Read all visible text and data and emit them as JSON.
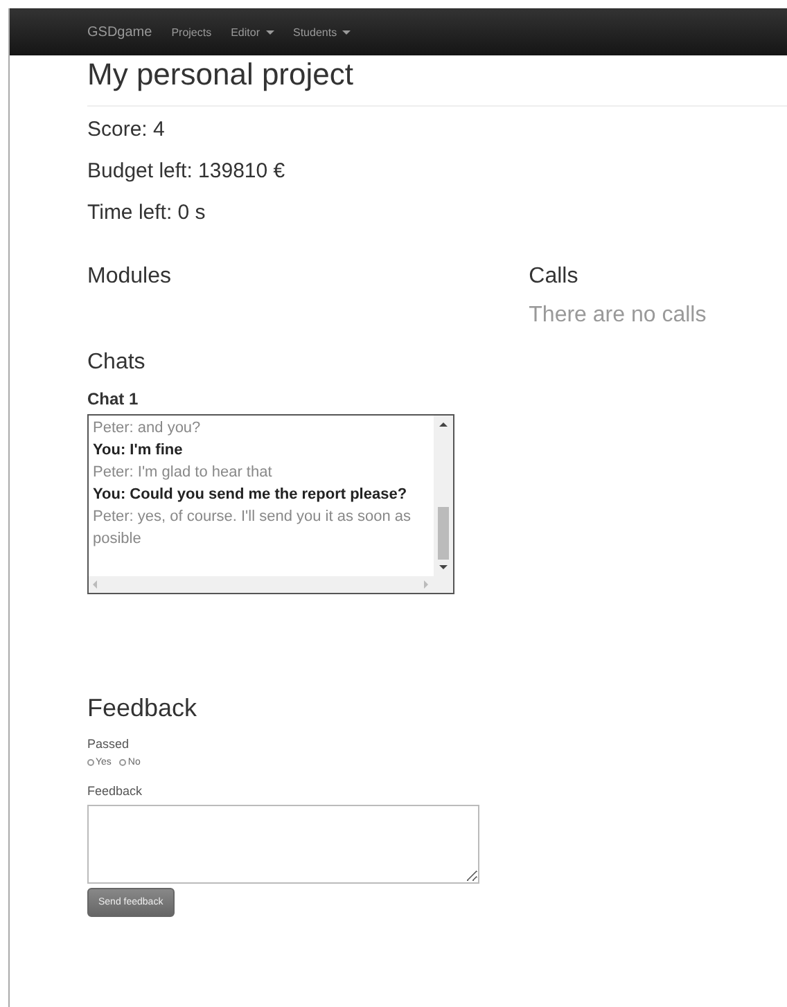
{
  "navbar": {
    "brand": "GSDgame",
    "items": [
      {
        "label": "Projects",
        "dropdown": false
      },
      {
        "label": "Editor",
        "dropdown": true
      },
      {
        "label": "Students",
        "dropdown": true
      }
    ]
  },
  "title": "My personal project",
  "stats": [
    "Score: 4",
    "Budget left: 139810 €",
    "Time left: 0 s"
  ],
  "modules": {
    "heading": "Modules"
  },
  "calls": {
    "heading": "Calls",
    "empty": "There are no calls"
  },
  "chats": {
    "heading": "Chats",
    "items": [
      {
        "title": "Chat 1",
        "messages": [
          {
            "kind": "other",
            "text": "Peter: and you?"
          },
          {
            "kind": "you",
            "text": "You: I'm fine"
          },
          {
            "kind": "other",
            "text": "Peter: I'm glad to hear that"
          },
          {
            "kind": "you",
            "text": "You: Could you send me the report please?"
          },
          {
            "kind": "other",
            "text": "Peter: yes, of course. I'll send you it as soon as posible"
          }
        ]
      }
    ]
  },
  "feedback": {
    "heading": "Feedback",
    "passed_label": "Passed",
    "options": [
      {
        "label": "Yes",
        "selected": false
      },
      {
        "label": "No",
        "selected": false
      }
    ],
    "feedback_label": "Feedback",
    "button": "Send feedback"
  }
}
